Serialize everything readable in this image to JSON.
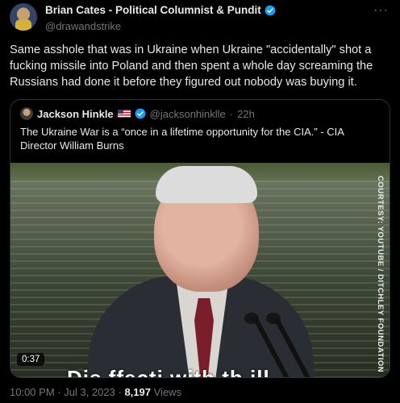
{
  "tweet": {
    "author_name": "Brian Cates - Political Columnist & Pundit",
    "author_handle": "@drawandstrike",
    "more_icon": "more-dots-icon",
    "text": "Same asshole that was in Ukraine when Ukraine \"accidentally\" shot a fucking missile into Poland and then spent a whole day screaming the Russians had done it before they figured out nobody was buying it.",
    "time": "10:00 PM",
    "date": "Jul 3, 2023",
    "separator": "·",
    "views_count": "8,197",
    "views_label": "Views"
  },
  "quote": {
    "author_name": "Jackson Hinkle",
    "author_handle": "@jacksonhinklle",
    "separator": "·",
    "age": "22h",
    "text": "The Ukraine War is a “once in a lifetime opportunity for the CIA.” - CIA Director William Burns",
    "video": {
      "duration": "0:37",
      "watermark": "COURTESY: YOUTUBE / DITCHLEY FOUNDATION",
      "caption_partial": "Dis ffecti    with th     ill"
    }
  },
  "colors": {
    "background": "#000000",
    "text": "#e7e9ea",
    "secondary": "#71767b",
    "verified": "#1d9bf0",
    "border": "#2f3336"
  }
}
